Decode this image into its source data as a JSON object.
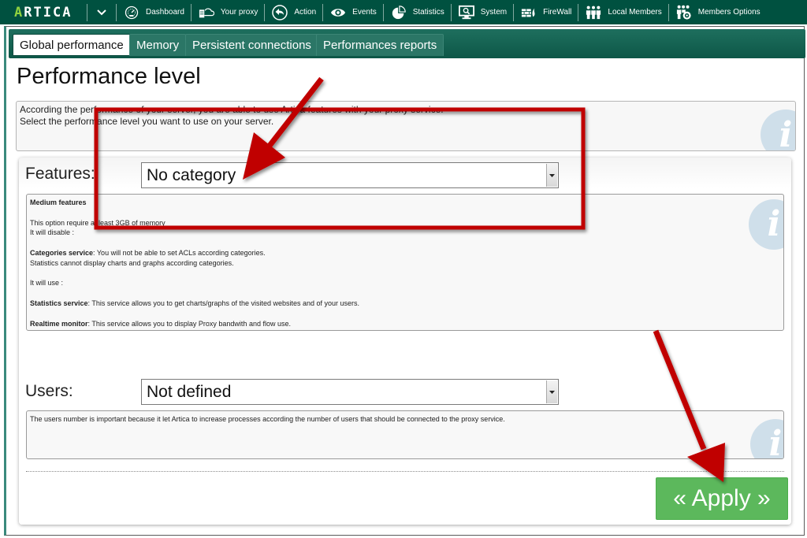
{
  "navbar": {
    "logo": {
      "first": "A",
      "rest": "RTICA"
    },
    "items": [
      {
        "label": "Dashboard",
        "icon": "dashboard-gauge-icon"
      },
      {
        "label": "Your proxy",
        "icon": "proxy-cloud-icon"
      },
      {
        "label": "Action",
        "icon": "action-arrow-icon"
      },
      {
        "label": "Events",
        "icon": "eye-icon"
      },
      {
        "label": "Statistics",
        "icon": "pie-chart-icon"
      },
      {
        "label": "System",
        "icon": "monitor-search-icon"
      },
      {
        "label": "FireWall",
        "icon": "firewall-icon"
      },
      {
        "label": "Local Members",
        "icon": "members-icon"
      },
      {
        "label": "Members Options",
        "icon": "members-options-icon"
      }
    ]
  },
  "tabs": [
    {
      "label": "Global performance",
      "active": true
    },
    {
      "label": "Memory",
      "active": false
    },
    {
      "label": "Persistent connections",
      "active": false
    },
    {
      "label": "Performances reports",
      "active": false
    }
  ],
  "page": {
    "title": "Performance level",
    "intro_lines": [
      "According the performance of your server, you are able to use Artica features with your proxy service.",
      "Select the performance level you want to use on your server."
    ]
  },
  "features": {
    "label": "Features:",
    "selected": "No category",
    "description": {
      "heading": "Medium features",
      "memory_note": "This option require at least 3GB of memory",
      "disable_header": "It will disable :",
      "categories_title": "Categories service",
      "categories_text": ": You will not be able to set ACLs according categories.",
      "categories_text2": "Statistics cannot display charts and graphs according categories.",
      "use_header": "It will use :",
      "statistics_title": "Statistics service",
      "statistics_text": ": This service allows you to get charts/graphs of the visited websites and of your users.",
      "realtime_title": "Realtime monitor",
      "realtime_text": ": This service allows you to display Proxy bandwith and flow use."
    }
  },
  "users": {
    "label": "Users:",
    "selected": "Not defined",
    "description": "The users number is important because it let Artica to increase processes according the number of users that should be connected to the proxy service."
  },
  "apply_button": {
    "label": "« Apply »"
  },
  "colors": {
    "navbar_bg": "#005140",
    "logo_accent": "#8fd13f",
    "apply_bg": "#5cb85c",
    "annotation_red": "#c00000",
    "watermark": "#cfdfea"
  }
}
